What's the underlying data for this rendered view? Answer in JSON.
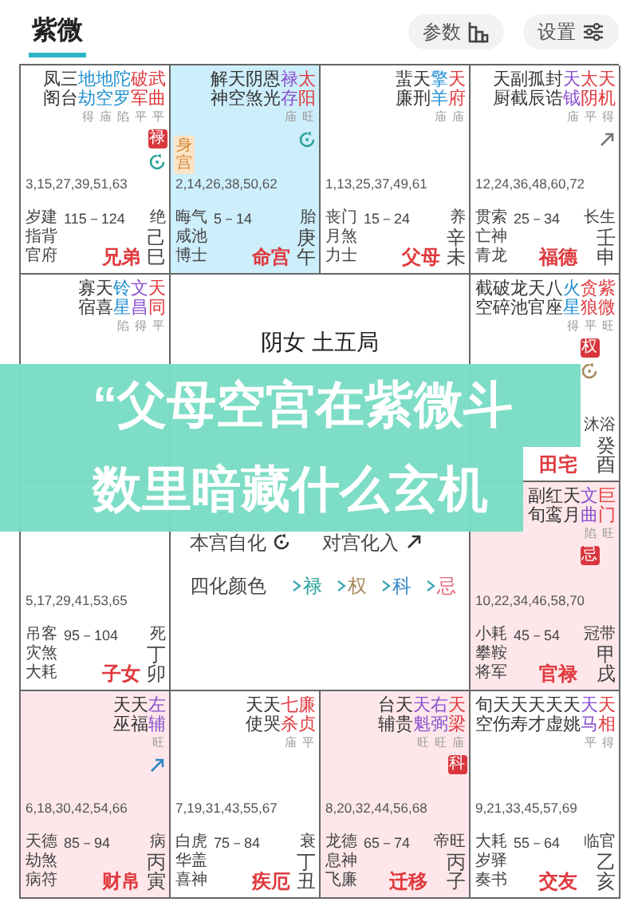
{
  "header": {
    "tabs": [
      {
        "label": "紫微",
        "selected": true
      }
    ],
    "buttons": [
      {
        "label": "参数",
        "kind": "params"
      },
      {
        "label": "设置",
        "kind": "settings"
      }
    ]
  },
  "chart": {
    "palaces": [
      {
        "selected": false,
        "highlighted": false,
        "stars": [
          {
            "name": "凤阁",
            "kind": "minor"
          },
          {
            "name": "三台",
            "kind": "minor"
          },
          {
            "name": "地劫",
            "kind": "malefic",
            "brightness": "得"
          },
          {
            "name": "地空",
            "kind": "malefic",
            "brightness": "庙"
          },
          {
            "name": "陀罗",
            "kind": "malefic",
            "brightness": "陷"
          },
          {
            "name": "破军",
            "kind": "major",
            "brightness": "平"
          },
          {
            "name": "武曲",
            "kind": "major",
            "brightness": "平",
            "transform": "禄",
            "markers": [
              {
                "kind": "self",
                "color": "#2aa39a"
              }
            ]
          }
        ],
        "ages": "3,15,27,39,51,63",
        "officers": [
          "岁建",
          "指背",
          "官府"
        ],
        "decade": "115－124",
        "life_stage": "绝",
        "stem": "己",
        "branch": "巳",
        "name": "兄弟"
      },
      {
        "selected": true,
        "body_palace": "身宫",
        "stars": [
          {
            "name": "解神",
            "kind": "minor"
          },
          {
            "name": "天空",
            "kind": "minor"
          },
          {
            "name": "阴煞",
            "kind": "minor"
          },
          {
            "name": "恩光",
            "kind": "minor"
          },
          {
            "name": "禄存",
            "kind": "lucky",
            "brightness": "庙"
          },
          {
            "name": "太阳",
            "kind": "major",
            "brightness": "旺",
            "markers": [
              {
                "kind": "self",
                "color": "#2aa39a"
              }
            ]
          }
        ],
        "ages": "2,14,26,38,50,62",
        "officers": [
          "晦气",
          "咸池",
          "博士"
        ],
        "decade": "5－14",
        "life_stage": "胎",
        "stem": "庚",
        "branch": "午",
        "name": "命宫"
      },
      {
        "selected": false,
        "highlighted": false,
        "stars": [
          {
            "name": "蜚廉",
            "kind": "minor"
          },
          {
            "name": "天刑",
            "kind": "minor"
          },
          {
            "name": "擎羊",
            "kind": "malefic",
            "brightness": "庙"
          },
          {
            "name": "天府",
            "kind": "major",
            "brightness": "庙"
          }
        ],
        "ages": "1,13,25,37,49,61",
        "officers": [
          "丧门",
          "月煞",
          "力士"
        ],
        "decade": "15－24",
        "life_stage": "养",
        "stem": "辛",
        "branch": "未",
        "name": "父母"
      },
      {
        "selected": false,
        "highlighted": false,
        "stars": [
          {
            "name": "天厨",
            "kind": "minor"
          },
          {
            "name": "副截",
            "kind": "minor"
          },
          {
            "name": "孤辰",
            "kind": "minor"
          },
          {
            "name": "封诰",
            "kind": "minor"
          },
          {
            "name": "天钺",
            "kind": "lucky",
            "brightness": "庙"
          },
          {
            "name": "太阴",
            "kind": "major",
            "brightness": "平"
          },
          {
            "name": "天机",
            "kind": "major",
            "brightness": "得",
            "markers": [
              {
                "kind": "opposite",
                "color": "#777777"
              }
            ]
          }
        ],
        "ages": "12,24,36,48,60,72",
        "officers": [
          "贯索",
          "亡神",
          "青龙"
        ],
        "decade": "25－34",
        "life_stage": "长生",
        "stem": "壬",
        "branch": "申",
        "name": "福德"
      },
      {
        "selected": false,
        "highlighted": false,
        "stars": [
          {
            "name": "寡宿",
            "kind": "minor"
          },
          {
            "name": "天喜",
            "kind": "minor"
          },
          {
            "name": "铃星",
            "kind": "malefic",
            "brightness": "陷"
          },
          {
            "name": "文昌",
            "kind": "lucky",
            "brightness": "得"
          },
          {
            "name": "天同",
            "kind": "major",
            "brightness": "平"
          }
        ]
      },
      {
        "selected": false,
        "highlighted": false,
        "stars": [
          {
            "name": "截空",
            "kind": "minor"
          },
          {
            "name": "破碎",
            "kind": "minor"
          },
          {
            "name": "龙池",
            "kind": "minor"
          },
          {
            "name": "天官",
            "kind": "minor"
          },
          {
            "name": "八座",
            "kind": "minor"
          },
          {
            "name": "火星",
            "kind": "malefic",
            "brightness": "得"
          },
          {
            "name": "贪狼",
            "kind": "major",
            "brightness": "平",
            "transform": "权",
            "markers": [
              {
                "kind": "self",
                "color": "#a4885a"
              }
            ]
          },
          {
            "name": "紫微",
            "kind": "major",
            "brightness": "旺"
          }
        ],
        "life_stage": "沐浴",
        "stem": "癸",
        "branch": "酉",
        "name": "田宅"
      },
      {
        "selected": false,
        "highlighted": false,
        "ages": "5,17,29,41,53,65",
        "officers": [
          "吊客",
          "灾煞",
          "大耗"
        ],
        "decade": "95－104",
        "life_stage": "死",
        "stem": "丁",
        "branch": "卯",
        "name": "子女"
      },
      {
        "selected": false,
        "highlighted": true,
        "stars": [
          {
            "name": "副旬",
            "kind": "minor"
          },
          {
            "name": "红鸾",
            "kind": "minor"
          },
          {
            "name": "天月",
            "kind": "minor"
          },
          {
            "name": "文曲",
            "kind": "lucky",
            "brightness": "陷",
            "transform": "忌"
          },
          {
            "name": "巨门",
            "kind": "major",
            "brightness": "旺"
          }
        ],
        "ages": "10,22,34,46,58,70",
        "officers": [
          "小耗",
          "攀鞍",
          "将军"
        ],
        "decade": "45－54",
        "life_stage": "冠带",
        "stem": "甲",
        "branch": "戌",
        "name": "官禄"
      },
      {
        "selected": false,
        "highlighted": true,
        "stars": [
          {
            "name": "天巫",
            "kind": "minor"
          },
          {
            "name": "天福",
            "kind": "minor"
          },
          {
            "name": "左辅",
            "kind": "lucky",
            "brightness": "旺",
            "markers": [
              {
                "kind": "opposite",
                "color": "#2f86c8"
              }
            ]
          }
        ],
        "ages": "6,18,30,42,54,66",
        "officers": [
          "天德",
          "劫煞",
          "病符"
        ],
        "decade": "85－94",
        "life_stage": "病",
        "stem": "丙",
        "branch": "寅",
        "name": "财帛"
      },
      {
        "selected": false,
        "highlighted": false,
        "stars": [
          {
            "name": "天使",
            "kind": "minor"
          },
          {
            "name": "天哭",
            "kind": "minor"
          },
          {
            "name": "七杀",
            "kind": "major",
            "brightness": "庙"
          },
          {
            "name": "廉贞",
            "kind": "major",
            "brightness": "平"
          }
        ],
        "ages": "7,19,31,43,55,67",
        "officers": [
          "白虎",
          "华盖",
          "喜神"
        ],
        "decade": "75－84",
        "life_stage": "衰",
        "stem": "丁",
        "branch": "丑",
        "name": "疾厄"
      },
      {
        "selected": false,
        "highlighted": true,
        "stars": [
          {
            "name": "台辅",
            "kind": "minor"
          },
          {
            "name": "天贵",
            "kind": "minor"
          },
          {
            "name": "天魁",
            "kind": "lucky",
            "brightness": "旺"
          },
          {
            "name": "右弼",
            "kind": "lucky",
            "brightness": "旺"
          },
          {
            "name": "天梁",
            "kind": "major",
            "brightness": "庙",
            "transform": "科"
          }
        ],
        "ages": "8,20,32,44,56,68",
        "officers": [
          "龙德",
          "息神",
          "飞廉"
        ],
        "decade": "65－74",
        "life_stage": "帝旺",
        "stem": "丙",
        "branch": "子",
        "name": "迁移"
      },
      {
        "selected": false,
        "highlighted": false,
        "stars": [
          {
            "name": "旬空",
            "kind": "minor"
          },
          {
            "name": "天伤",
            "kind": "minor"
          },
          {
            "name": "天寿",
            "kind": "minor"
          },
          {
            "name": "天才",
            "kind": "minor"
          },
          {
            "name": "天虚",
            "kind": "minor"
          },
          {
            "name": "天姚",
            "kind": "minor"
          },
          {
            "name": "天马",
            "kind": "lucky",
            "brightness": "平"
          },
          {
            "name": "天相",
            "kind": "major",
            "brightness": "得"
          }
        ],
        "ages": "9,21,33,45,57,69",
        "officers": [
          "大耗",
          "岁驿",
          "奏书"
        ],
        "decade": "55－64",
        "life_stage": "临官",
        "stem": "乙",
        "branch": "亥",
        "name": "交友"
      }
    ],
    "center": {
      "title": "阴女 土五局",
      "legend": [
        {
          "label": "本宫自化",
          "kind": "self"
        },
        {
          "label": "对宫化入",
          "kind": "opposite"
        }
      ],
      "color_legend": {
        "label": "四化颜色",
        "items": [
          {
            "label": "禄",
            "color": "#2aa39a"
          },
          {
            "label": "权",
            "color": "#a4885a"
          },
          {
            "label": "科",
            "color": "#2f86c8"
          },
          {
            "label": "忌",
            "color": "#e2677a"
          }
        ]
      }
    }
  },
  "overlay_headline": [
    "“父母空宫在紫微斗",
    "数里暗藏什么玄机"
  ]
}
